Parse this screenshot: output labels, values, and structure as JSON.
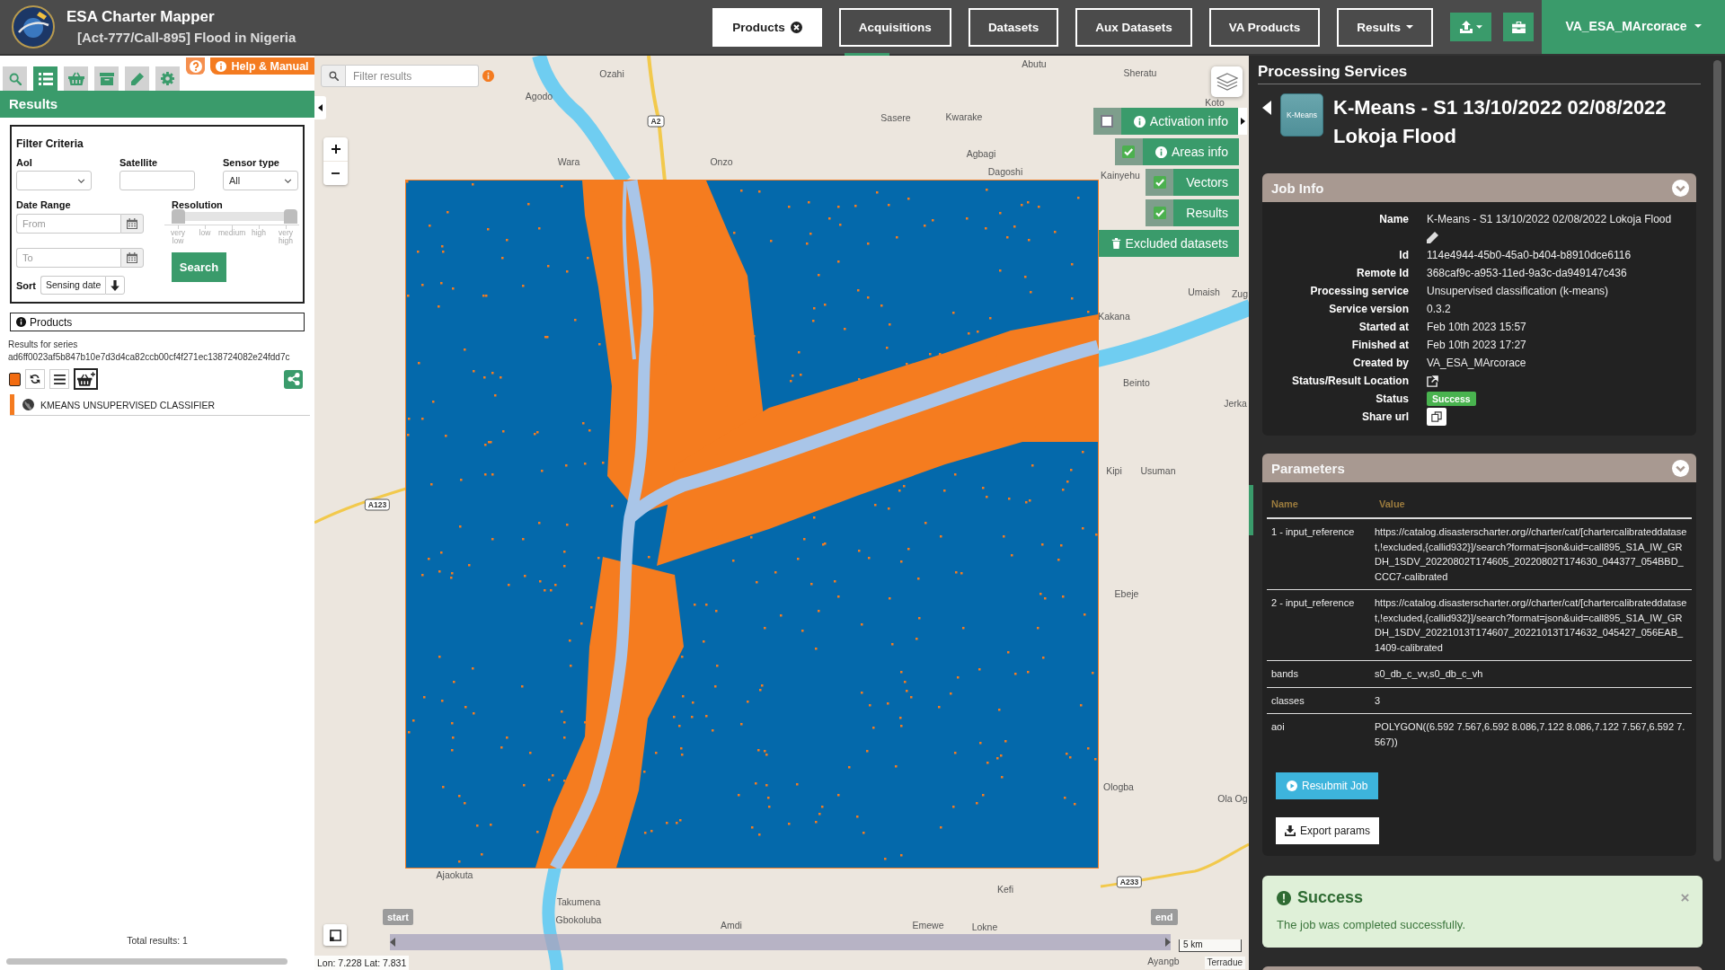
{
  "header": {
    "app_title": "ESA Charter Mapper",
    "activation": "[Act-777/Call-895] Flood in Nigeria",
    "nav": [
      {
        "label": "Products",
        "kind": "closable",
        "selected": true,
        "highlighted": false
      },
      {
        "label": "Acquisitions",
        "kind": "plain",
        "selected": false,
        "highlighted": true
      },
      {
        "label": "Datasets",
        "kind": "plain",
        "selected": false,
        "highlighted": false
      },
      {
        "label": "Aux Datasets",
        "kind": "plain",
        "selected": false,
        "highlighted": false
      },
      {
        "label": "VA Products",
        "kind": "plain",
        "selected": false,
        "highlighted": false
      },
      {
        "label": "Results",
        "kind": "dropdown",
        "selected": false,
        "highlighted": false
      }
    ],
    "user": "VA_ESA_MArcorace"
  },
  "left_panel": {
    "tabs": [
      {
        "kind": "search",
        "selected": false
      },
      {
        "kind": "list",
        "selected": true
      },
      {
        "kind": "basket",
        "selected": false
      },
      {
        "kind": "archive",
        "selected": false
      },
      {
        "kind": "pencil",
        "selected": false
      },
      {
        "kind": "gear",
        "selected": false
      }
    ],
    "help_button": "Help & Manual",
    "title": "Results",
    "filter": {
      "title": "Filter Criteria",
      "aoi_label": "AoI",
      "satellite_label": "Satellite",
      "sensor_label": "Sensor type",
      "sensor_value": "All",
      "date_label": "Date Range",
      "from": {
        "placeholder": "From"
      },
      "to": {
        "placeholder": "To"
      },
      "resolution_label": "Resolution",
      "resolution_thumbs": [
        {
          "level": 0
        },
        {
          "level": 1
        }
      ],
      "resolution_ticks": [
        "very low",
        "low",
        "medium",
        "high",
        "very high"
      ],
      "search_button": "Search",
      "sort_label": "Sort",
      "sort_value": "Sensing date"
    },
    "products": {
      "title": "Products",
      "series_label": "Results for series",
      "series_id": "ad6ff0023af5b847b10e7d3d4ca82ccb00cf4f271ec138724082e24fdd7c",
      "items": [
        {
          "name": "KMEANS UNSUPERVISED CLASSIFIER",
          "color": "#f47b20"
        }
      ],
      "total": "Total results: 1"
    }
  },
  "map": {
    "filter": {
      "placeholder": "Filter results"
    },
    "layers": [
      {
        "label": "Activation info",
        "checked": false,
        "info": true
      },
      {
        "label": "Areas info",
        "checked": true,
        "info": true
      },
      {
        "label": "Vectors",
        "checked": true,
        "info": false
      },
      {
        "label": "Results",
        "checked": true,
        "info": false
      }
    ],
    "excluded_button": "Excluded datasets",
    "places": [
      "Abutu",
      "Ozahi",
      "Sheratu",
      "Agodo",
      "Koto",
      "Sasere",
      "Kwarake",
      "Wara",
      "Onzo",
      "Agbagi",
      "Dagoshi",
      "Kainyehu",
      "Umaish",
      "Zug",
      "Kakana",
      "Beinto",
      "Jerka",
      "Kipi",
      "Usuman",
      "Ebeje",
      "Ologba",
      "Ola Og",
      "Kefi",
      "Ajaokuta",
      "Takumena",
      "Gbokoluba",
      "Amdi",
      "Emewe",
      "Lokne",
      "Ayangb"
    ],
    "roads": [
      "A2",
      "A123",
      "A233"
    ],
    "timeline": {
      "start": "start",
      "end": "end"
    },
    "scale": "5 km",
    "coordinates": "Lon: 7.228 Lat: 7.831",
    "attribution": "Terradue"
  },
  "right_panel": {
    "title": "Processing Services",
    "service_logo": "K-Means",
    "job_title": "K-Means - S1 13/10/2022 02/08/2022 Lokoja Flood",
    "job_info": {
      "title": "Job Info",
      "rows": [
        {
          "kind": "editable",
          "label": "Name",
          "value": "K-Means - S1 13/10/2022 02/08/2022 Lokoja Flood"
        },
        {
          "kind": "text",
          "label": "Id",
          "value": "114e4944-45b0-45a0-b404-b8910dce6116"
        },
        {
          "kind": "text",
          "label": "Remote Id",
          "value": "368caf9c-a953-11ed-9a3c-da949147c436"
        },
        {
          "kind": "text",
          "label": "Processing service",
          "value": "Unsupervised classification (k-means)"
        },
        {
          "kind": "text",
          "label": "Service version",
          "value": "0.3.2"
        },
        {
          "kind": "text",
          "label": "Started at",
          "value": "Feb 10th 2023 15:57"
        },
        {
          "kind": "text",
          "label": "Finished at",
          "value": "Feb 10th 2023 17:27"
        },
        {
          "kind": "text",
          "label": "Created by",
          "value": "VA_ESA_MArcorace"
        },
        {
          "kind": "link",
          "label": "Status/Result Location"
        },
        {
          "kind": "badge",
          "label": "Status",
          "value": "Success"
        },
        {
          "kind": "copy",
          "label": "Share url"
        }
      ]
    },
    "parameters": {
      "title": "Parameters",
      "columns": [
        "Name",
        "Value"
      ],
      "rows": [
        {
          "name": "1 - input_reference",
          "value": "https://catalog.disasterscharter.org//charter/cat/[chartercalibrateddataset,!excluded,{callid932}]/search?format=json&uid=call895_S1A_IW_GRDH_1SDV_20220802T174605_20220802T174630_044377_054BBD_CCC7-calibrated"
        },
        {
          "name": "2 - input_reference",
          "value": "https://catalog.disasterscharter.org//charter/cat/[chartercalibrateddataset,!excluded,{callid932}]/search?format=json&uid=call895_S1A_IW_GRDH_1SDV_20221013T174607_20221013T174632_045427_056EAB_1409-calibrated"
        },
        {
          "name": "bands",
          "value": "s0_db_c_vv,s0_db_c_vh"
        },
        {
          "name": "classes",
          "value": "3"
        },
        {
          "name": "aoi",
          "value": "POLYGON((6.592 7.567,6.592 8.086,7.122 8.086,7.122 7.567,6.592 7.567))"
        }
      ]
    },
    "resubmit_button": "Resubmit Job",
    "export_button": "Export params",
    "alert": {
      "title": "Success",
      "message": "The job was completed successfully."
    }
  }
}
